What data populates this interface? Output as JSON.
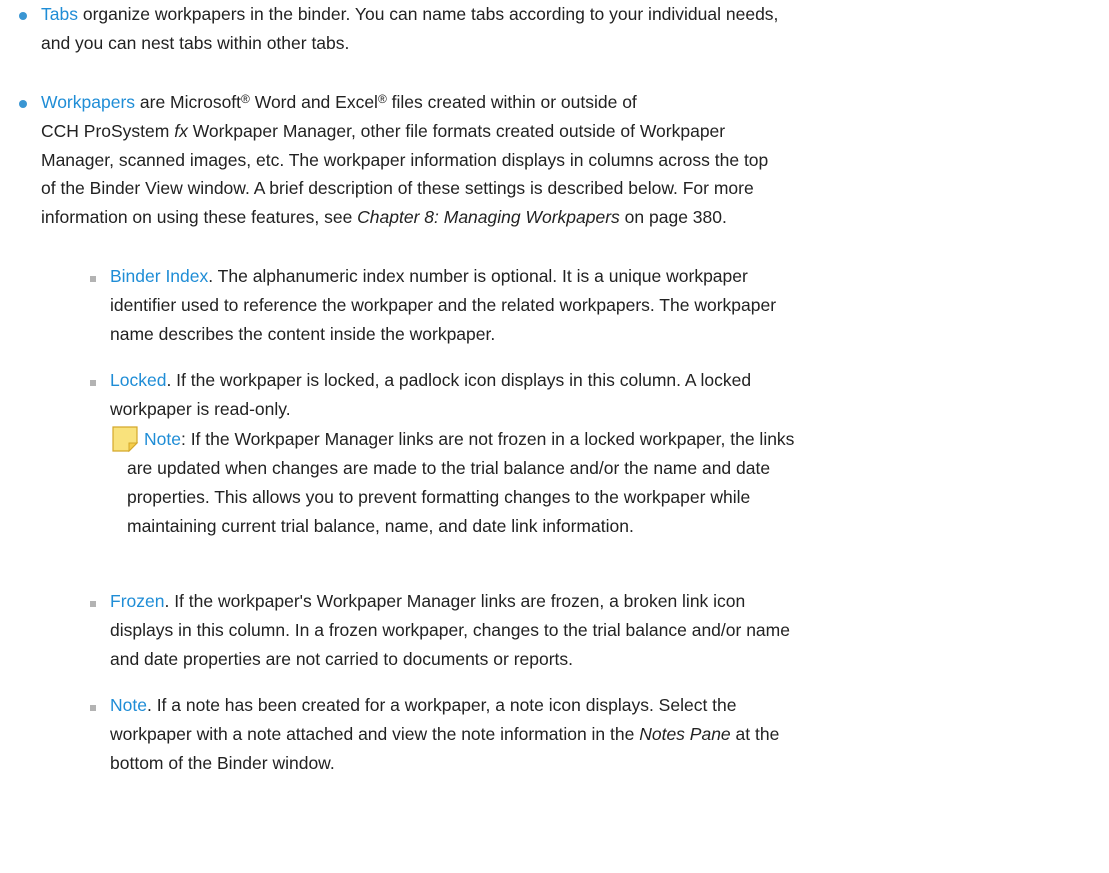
{
  "tabs_item": {
    "term": "Tabs",
    "line1": " organize workpapers in the binder. You can name tabs according to your individual needs,",
    "line2": "and you can nest tabs within other tabs."
  },
  "workpapers_item": {
    "term": "Workpapers",
    "line1_a": " are Microsoft",
    "reg1": "®",
    "line1_b": " Word and Excel",
    "reg2": "®",
    "line1_c": " files created within or outside of",
    "line2_a": "CCH ProSystem ",
    "line2_fx": "fx",
    "line2_b": " Workpaper Manager, other file formats created outside of Workpaper",
    "line3": "Manager, scanned images, etc. The workpaper information displays in columns across the top",
    "line4": "of the Binder View window. A brief description of these settings is described below. For more",
    "line5_a": "information on using these features, see ",
    "line5_ref": "Chapter 8: Managing Workpapers",
    "line5_b": "  on page 380."
  },
  "binder_index": {
    "term": "Binder Index",
    "line1": ". The alphanumeric index number is optional. It is a unique workpaper",
    "line2": "identifier used to reference the workpaper and the related workpapers. The workpaper",
    "line3": "name describes the content inside the workpaper."
  },
  "locked": {
    "term": "Locked",
    "line1": ". If the workpaper is locked, a padlock icon displays in this column. A locked",
    "line2": "workpaper is read-only."
  },
  "note_box": {
    "term": "Note",
    "line1": ": If the Workpaper Manager links are not frozen in a locked workpaper, the links",
    "line2": "are updated when changes are made to the trial balance and/or the name and date",
    "line3": "properties. This allows you to prevent formatting changes to the workpaper while",
    "line4": "maintaining current trial balance, name, and date link information.",
    "icon": "note-icon",
    "icon_color": "#f5d64a"
  },
  "frozen": {
    "term": "Frozen",
    "line1": ". If the workpaper's Workpaper Manager links are frozen, a broken link icon",
    "line2": "displays in this column. In a frozen workpaper, changes to the trial balance and/or name",
    "line3": "and date properties are not carried to documents or reports."
  },
  "note_item": {
    "term": "Note",
    "line1_a": ". If a note has been created for a workpaper, a note icon displays. Select the",
    "line2_a": "workpaper with a note attached and view the note information in the ",
    "line2_ref": "Notes Pane",
    "line2_b": " at the",
    "line3": "bottom of the Binder window."
  },
  "colors": {
    "term": "#1f8dd6",
    "bullet_level1": "#3a96d3",
    "bullet_level2": "#b3b3b3",
    "text": "#222222"
  }
}
